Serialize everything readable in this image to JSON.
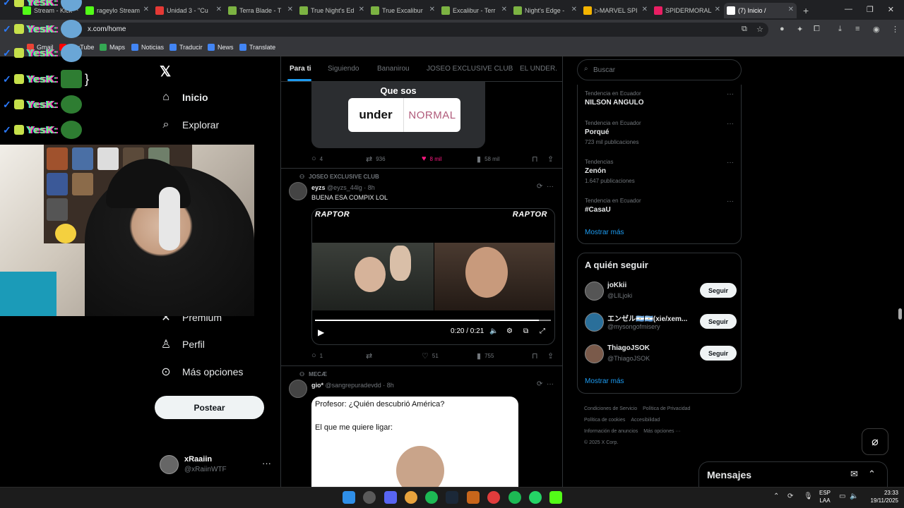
{
  "browser": {
    "tabs": [
      {
        "title": "Stream - Kick",
        "color": "#53fc18"
      },
      {
        "title": "rageylo Stream",
        "color": "#53fc18"
      },
      {
        "title": "Unidad 3 - \"Cu",
        "color": "#e53935"
      },
      {
        "title": "Terra Blade - T",
        "color": "#7cb342"
      },
      {
        "title": "True Night's Ed",
        "color": "#7cb342"
      },
      {
        "title": "True Excalibur",
        "color": "#7cb342"
      },
      {
        "title": "Excalibur - Terr",
        "color": "#7cb342"
      },
      {
        "title": "Night's Edge -",
        "color": "#7cb342"
      },
      {
        "title": "▷MARVEL SPI",
        "color": "#f4b400"
      },
      {
        "title": "SPIDERMORAL",
        "color": "#e91e63"
      },
      {
        "title": "(7) Inicio /",
        "color": "#ffffff"
      }
    ],
    "url": "x.com/home",
    "bookmarks": [
      "Gmail",
      "YouTube",
      "Maps",
      "Noticias",
      "Traducir",
      "News",
      "Translate"
    ]
  },
  "overlay": {
    "chat_name": "YesK:",
    "chat_suffix": "}"
  },
  "sidebar": {
    "nav": [
      {
        "label": "Inicio",
        "icon": "home-icon"
      },
      {
        "label": "Explorar",
        "icon": "search-icon"
      },
      {
        "label": "Premium",
        "icon": "x-logo-icon"
      },
      {
        "label": "Perfil",
        "icon": "profile-icon"
      },
      {
        "label": "Más opciones",
        "icon": "more-icon"
      }
    ],
    "post_label": "Postear",
    "account": {
      "name": "xRaaiin",
      "handle": "@xRaiinWTF"
    }
  },
  "feed": {
    "tabs": [
      "Para ti",
      "Siguiendo",
      "Bananirou",
      "JOSEO EXCLUSIVE CLUB",
      "EL UNDER."
    ],
    "post1": {
      "card_title": "Que sos",
      "card_left": "under",
      "card_right": "NORMAL",
      "replies": "4",
      "reposts": "936",
      "likes": "8 mil",
      "views": "58 mil"
    },
    "post2": {
      "community": "JOSEO EXCLUSIVE CLUB",
      "name": "eyzs",
      "handle": "@eyzs_44lg",
      "time": "· 8h",
      "text": "BUENA ESA COMPIX LOL",
      "video_brand": "RAPTOR",
      "video_time": "0:20 / 0:21",
      "video_progress": 0.95,
      "replies": "1",
      "reposts": "",
      "likes": "51",
      "views": "755"
    },
    "post3": {
      "community": "MECÆ",
      "name": "gio*",
      "handle": "@sangrepuradevdd",
      "time": "· 8h",
      "meme_line1": "Profesor: ¿Quién descubrió América?",
      "meme_line2": "El que me quiere ligar:"
    }
  },
  "right": {
    "search_placeholder": "Buscar",
    "trends": [
      {
        "context": "Tendencia en Ecuador",
        "topic": "NILSON ANGULO",
        "posts": ""
      },
      {
        "context": "Tendencia en Ecuador",
        "topic": "Porqué",
        "posts": "723 mil publicaciones"
      },
      {
        "context": "Tendencias",
        "topic": "Zenón",
        "posts": "1.647 publicaciones"
      },
      {
        "context": "Tendencia en Ecuador",
        "topic": "#CasaU",
        "posts": ""
      }
    ],
    "show_more": "Mostrar más",
    "who_title": "A quién seguir",
    "who": [
      {
        "name": "joKkii",
        "handle": "@LILjoki"
      },
      {
        "name": "エンゼル🇦🇷🇦🇷(xie/xem...",
        "handle": "@mysongofmisery"
      },
      {
        "name": "ThiagoJSOK",
        "handle": "@ThiagoJSOK"
      }
    ],
    "follow_label": "Seguir",
    "footer_links": [
      "Condiciones de Servicio",
      "Política de Privacidad",
      "Política de cookies",
      "Accesibilidad",
      "Información de anuncios",
      "Más opciones ···",
      "© 2025 X Corp."
    ],
    "messages_title": "Mensajes"
  },
  "taskbar": {
    "lang1": "ESP",
    "lang2": "LAA",
    "time": "23:33",
    "date": "19/11/2025"
  },
  "colors": {
    "accent": "#1d9bf0",
    "like": "#f91880",
    "bg": "#000000"
  }
}
